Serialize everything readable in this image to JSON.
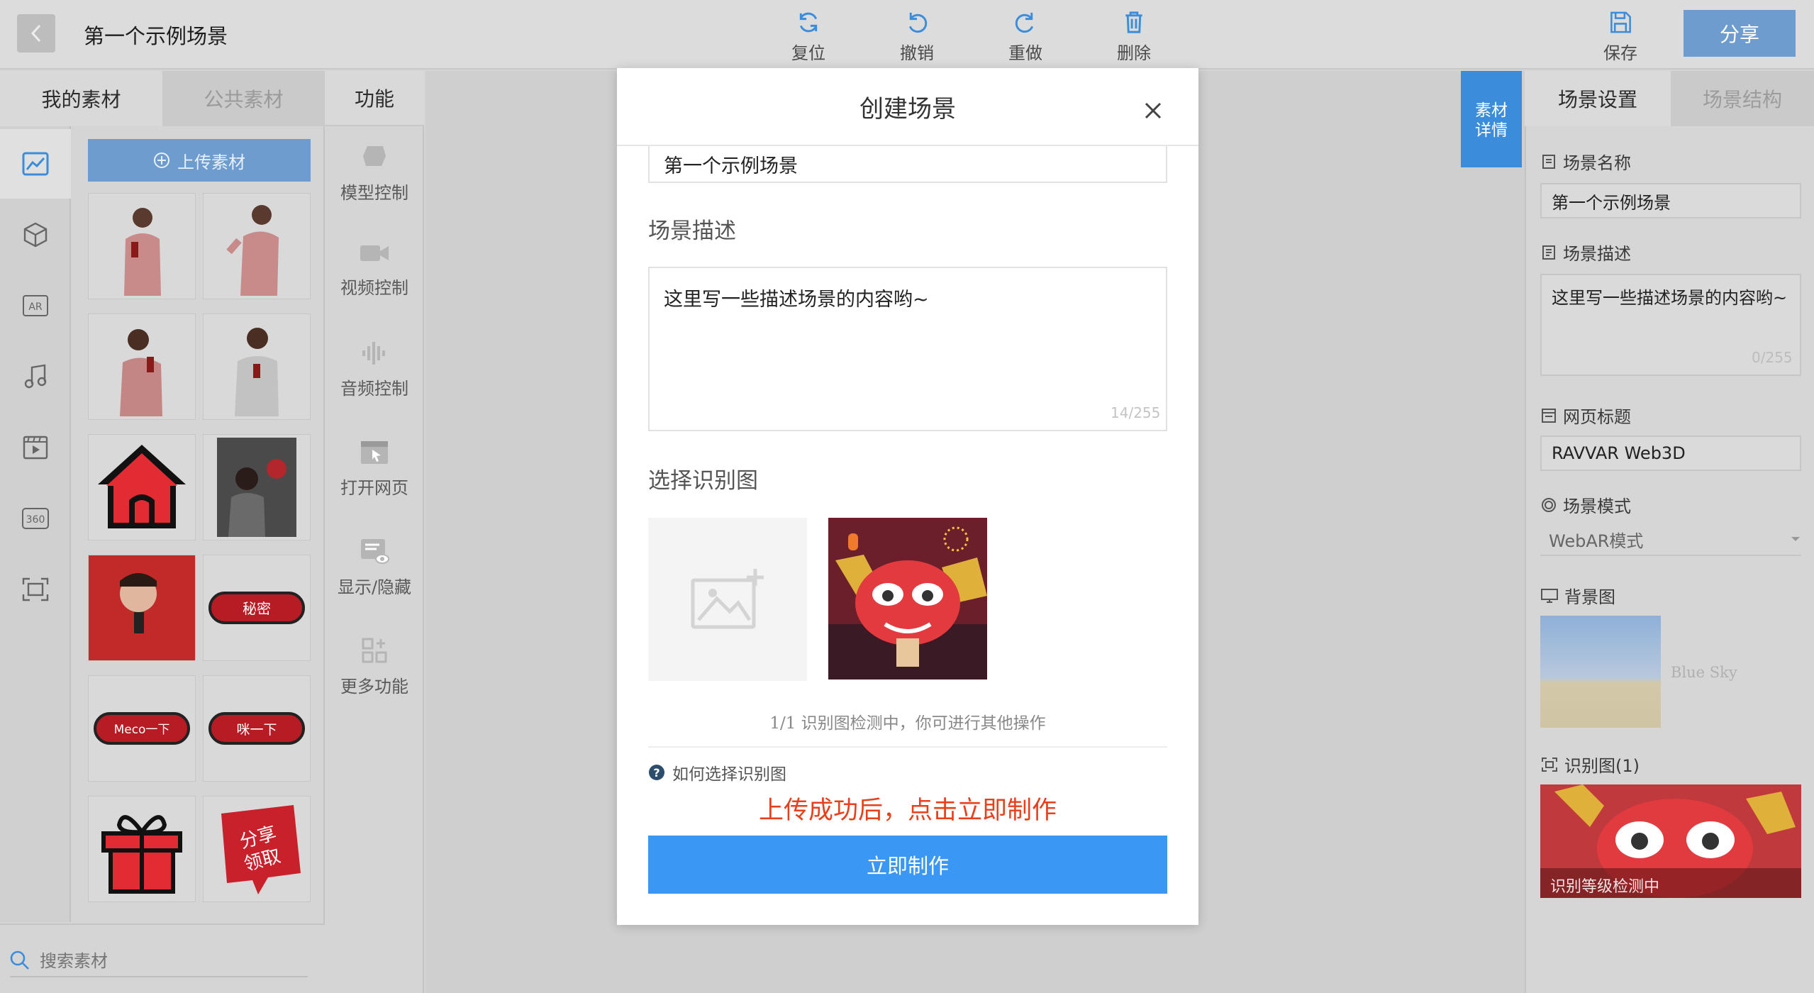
{
  "header": {
    "scene_title": "第一个示例场景",
    "tools": {
      "reset": "复位",
      "undo": "撤销",
      "redo": "重做",
      "delete": "删除"
    },
    "save": "保存",
    "share": "分享"
  },
  "left_panel": {
    "tab_my": "我的素材",
    "tab_public": "公共素材",
    "upload": "上传素材",
    "rail_icons": [
      "image-icon",
      "cube-icon",
      "ar-icon",
      "music-icon",
      "video-icon",
      "360-icon",
      "scan-icon"
    ],
    "rail_labels": {
      "ar": "AR",
      "pano": "360"
    },
    "assets": [
      "man-photo",
      "man-photo",
      "man-photo",
      "man-photo",
      "house-icon",
      "poster",
      "man-photo",
      "secret-button",
      "meco-button",
      "drink-button",
      "gift-icon",
      "share-claim-badge"
    ],
    "asset_texts": {
      "secret": "秘密",
      "meco": "Meco一下",
      "drink": "咪一下",
      "share_line1": "分享",
      "share_line2": "领取"
    },
    "search_placeholder": "搜索素材"
  },
  "func_panel": {
    "title": "功能",
    "items": [
      "模型控制",
      "视频控制",
      "音频控制",
      "打开网页",
      "显示/隐藏",
      "更多功能"
    ]
  },
  "material_detail": {
    "line1": "素材",
    "line2": "详情"
  },
  "right_panel": {
    "tab_settings": "场景设置",
    "tab_structure": "场景结构",
    "scene_name_label": "场景名称",
    "scene_name": "第一个示例场景",
    "scene_desc_label": "场景描述",
    "scene_desc": "这里写一些描述场景的内容哟~",
    "scene_desc_count": "0/255",
    "page_title_label": "网页标题",
    "page_title": "RAVVAR Web3D",
    "scene_mode_label": "场景模式",
    "scene_mode": "WebAR模式",
    "bg_label": "背景图",
    "bg_name": "Blue Sky",
    "marker_label": "识别图(1)",
    "marker_status": "识别等级检测中"
  },
  "modal": {
    "title": "创建场景",
    "name_value": "第一个示例场景",
    "desc_label": "场景描述",
    "desc_value": "这里写一些描述场景的内容哟~",
    "desc_count": "14/255",
    "marker_label": "选择识别图",
    "detect_status": "1/1 识别图检测中，你可进行其他操作",
    "help_link": "如何选择识别图",
    "instruction": "上传成功后，点击立即制作",
    "make_button": "立即制作"
  },
  "colors": {
    "primary": "#3a97f3",
    "instruction": "#e8401c",
    "share": "#6e9ccf"
  }
}
